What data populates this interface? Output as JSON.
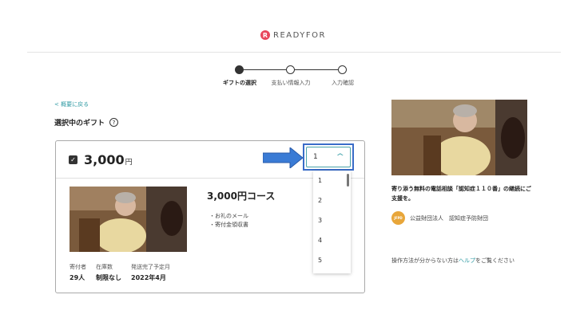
{
  "header": {
    "logo_mark": "R",
    "logo_text": "READYFOR"
  },
  "stepper": {
    "steps": [
      {
        "label": "ギフトの選択",
        "active": true
      },
      {
        "label": "支払い情報入力",
        "active": false
      },
      {
        "label": "入力確認",
        "active": false
      }
    ]
  },
  "back_link": "< 概要に戻る",
  "section_title": "選択中のギフト",
  "help_icon": "?",
  "gift": {
    "price": "3,000",
    "price_unit": "円",
    "title": "3,000円コース",
    "items": [
      "・お礼のメール",
      "・寄付金領収書"
    ],
    "stats": [
      {
        "label": "寄付者",
        "value": "29人"
      },
      {
        "label": "在庫数",
        "value": "制限なし"
      },
      {
        "label": "発送完了予定月",
        "value": "2022年4月"
      }
    ]
  },
  "quantity": {
    "selected": "1",
    "options": [
      "1",
      "2",
      "3",
      "4",
      "5"
    ]
  },
  "project": {
    "title": "寄り添う無料の電話相談「認知症１１０番」の継続にご支援を。",
    "org_avatar": "JFPD",
    "org_name": "公益財団法人　認知症予防財団"
  },
  "help": {
    "prefix": "操作方法が分からない方は",
    "link": "ヘルプ",
    "suffix": "をご覧ください"
  },
  "colors": {
    "accent": "#2f9aa3",
    "highlight": "#3a6cc8",
    "brand": "#e8465c"
  },
  "icons": {
    "logo": "readyfor-logo-icon",
    "checkbox": "checkbox-checked-icon",
    "chevron": "chevron-up-icon",
    "arrow": "arrow-right-icon",
    "help": "question-circle-icon"
  }
}
